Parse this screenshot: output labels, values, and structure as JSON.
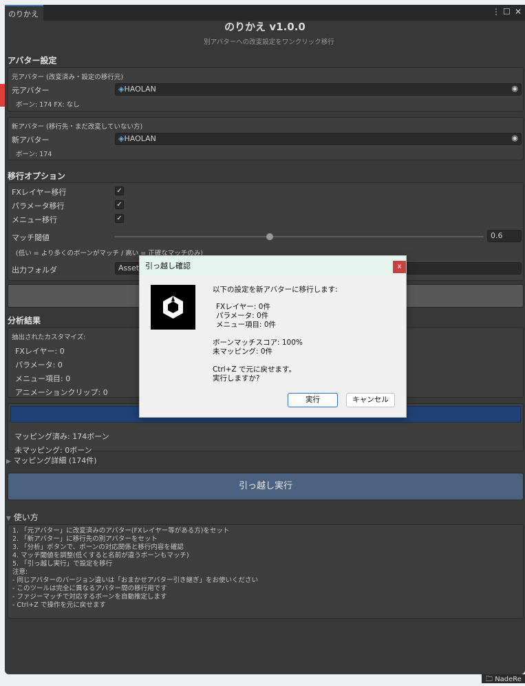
{
  "window": {
    "tab": "のりかえ",
    "title": "のりかえ v1.0.0",
    "subtitle": "別アバターへの改変設定をワンクリック移行"
  },
  "avatar_settings": {
    "header": "アバター設定",
    "source": {
      "box_label": "元アバター (改変済み・設定の移行元)",
      "field_label": "元アバター",
      "value": "HAOLAN",
      "info": "ボーン: 174  FX: なし"
    },
    "target": {
      "box_label": "新アバター (移行先・まだ改変していない方)",
      "field_label": "新アバター",
      "value": "HAOLAN",
      "info": "ボーン: 174"
    }
  },
  "options": {
    "header": "移行オプション",
    "checkboxes": [
      {
        "label": "FXレイヤー移行",
        "checked": true
      },
      {
        "label": "パラメータ移行",
        "checked": true
      },
      {
        "label": "メニュー移行",
        "checked": true
      }
    ],
    "threshold": {
      "label": "マッチ閾値",
      "value": "0.6",
      "fraction": 0.6,
      "hint": "(低い = より多くのボーンがマッチ / 高い = 正確なマッチのみ)"
    },
    "output_folder": {
      "label": "出力フォルダ",
      "value": "Assets"
    }
  },
  "analysis": {
    "header": "分析結果",
    "extracted_label": "抽出されたカスタマイズ:",
    "items": [
      "FXレイヤー: 0",
      "パラメータ: 0",
      "メニュー項目: 0",
      "アニメーションクリップ: 0"
    ],
    "mapped": "マッピング済み: 174ボーン",
    "unmapped": "未マッピング: 0ボーン"
  },
  "mapping_detail": "マッピング詳細 (174件)",
  "execute_button": "引っ越し実行",
  "usage": {
    "header": "使い方",
    "lines": [
      "1. 「元アバター」に改変済みのアバター(FXレイヤー等がある方)をセット",
      "2. 「新アバター」に移行先の別アバターをセット",
      "3. 「分析」ボタンで、ボーンの対応関係と移行内容を確認",
      "4. マッチ閾値を調整(低くすると名前が違うボーンもマッチ)",
      "5. 「引っ越し実行」で設定を移行",
      "",
      "注意:",
      "- 同じアバターのバージョン違いは「おまかせアバター引き継ぎ」をお使いください",
      "- このツールは完全に異なるアバター間の移行用です",
      "- ファジーマッチで対応するボーンを自動推定します",
      "- Ctrl+Z で操作を元に戻せます"
    ]
  },
  "dialog": {
    "title": "引っ越し確認",
    "close": "x",
    "heading": "以下の設定を新アバターに移行します:",
    "details": [
      "FXレイヤー: 0件",
      "パラメータ: 0件",
      "メニュー項目: 0件"
    ],
    "score": "ボーンマッチスコア: 100%",
    "unmapped": "未マッピング: 0件",
    "undo": "Ctrl+Z で元に戻せます。",
    "confirm": "実行しますか?",
    "ok": "実行",
    "cancel": "キャンセル"
  },
  "taskbar": {
    "folder": "NadeRe"
  }
}
